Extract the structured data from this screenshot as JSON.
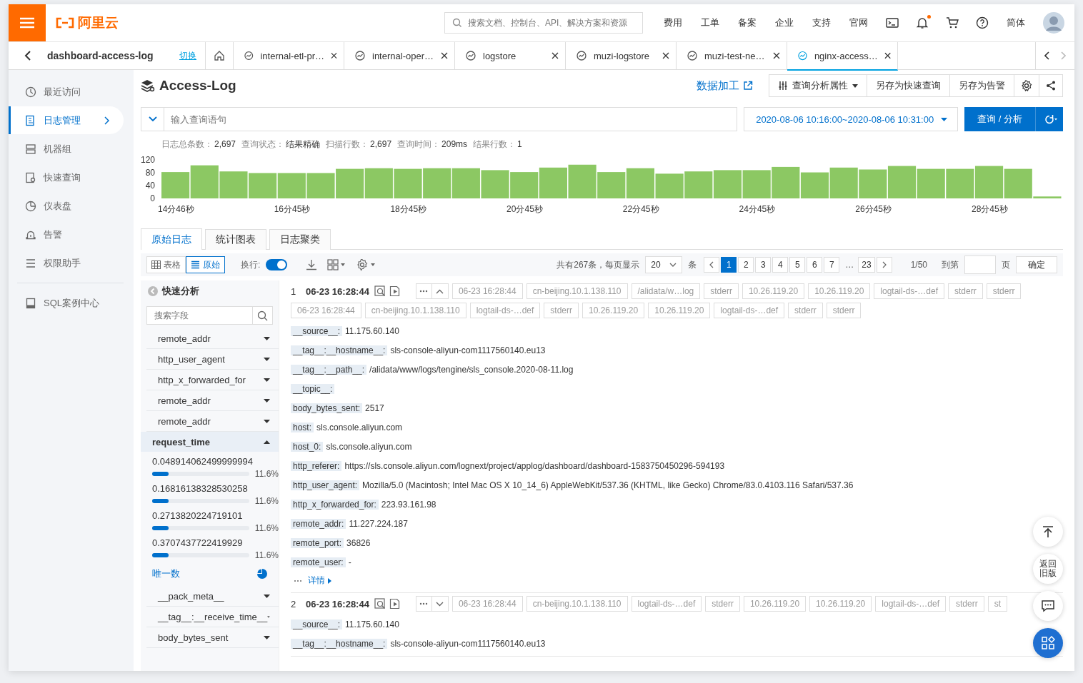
{
  "topbar": {
    "logo": "阿里云",
    "search": {
      "placeholder": "搜索文档、控制台、API、解决方案和资源"
    },
    "links": [
      "费用",
      "工单",
      "备案",
      "企业",
      "支持",
      "官网"
    ],
    "notification_dot": true,
    "language": "简体"
  },
  "tabbar": {
    "project": "dashboard-access-log",
    "switch_link": "切换",
    "tabs": [
      {
        "label": "internal-etl-pr…",
        "selected": false
      },
      {
        "label": "internal-oper…",
        "selected": false
      },
      {
        "label": "logstore",
        "selected": false
      },
      {
        "label": "muzi-logstore",
        "selected": false
      },
      {
        "label": "muzi-test-ne…",
        "selected": false
      },
      {
        "label": "nginx-access…",
        "selected": true
      }
    ]
  },
  "sidebar": {
    "items": [
      {
        "label": "最近访问",
        "selected": false
      },
      {
        "label": "日志管理",
        "selected": true
      },
      {
        "label": "机器组",
        "selected": false
      },
      {
        "label": "快速查询",
        "selected": false
      },
      {
        "label": "仪表盘",
        "selected": false
      },
      {
        "label": "告警",
        "selected": false
      },
      {
        "label": "权限助手",
        "selected": false
      }
    ],
    "footer_items": [
      {
        "label": "SQL案例中心",
        "selected": false
      }
    ]
  },
  "logstore": {
    "title": "Access-Log",
    "data_processing_link": "数据加工",
    "actions": [
      "查询分析属性",
      "另存为快速查询",
      "另存为告警"
    ]
  },
  "query": {
    "placeholder": "输入查询语句",
    "time_range": "2020-08-06 10:16:00~2020-08-06 10:31:00",
    "submit": "查询 / 分析"
  },
  "stats": [
    {
      "label": "日志总条数：",
      "value": "2,697"
    },
    {
      "label": "查询状态：",
      "value": "结果精确"
    },
    {
      "label": "扫描行数：",
      "value": "2,697"
    },
    {
      "label": "查询时间：",
      "value": "209ms"
    },
    {
      "label": "结果行数：",
      "value": "1"
    }
  ],
  "histogram": {
    "chart_data": {
      "type": "bar",
      "values": [
        82,
        103,
        84,
        79,
        79,
        79,
        92,
        94,
        92,
        94,
        94,
        88,
        82,
        96,
        105,
        82,
        94,
        77,
        84,
        88,
        88,
        98,
        81,
        96,
        90,
        101,
        92,
        92,
        101,
        92,
        6
      ],
      "categories": [
        "14分46秒",
        null,
        null,
        null,
        "16分45秒",
        null,
        null,
        null,
        "18分45秒",
        null,
        null,
        null,
        "20分45秒",
        null,
        null,
        null,
        "22分45秒",
        null,
        null,
        null,
        "24分45秒",
        null,
        null,
        null,
        "26分45秒",
        null,
        null,
        null,
        "28分45秒",
        null,
        null
      ],
      "ylim": [
        0,
        120
      ],
      "yticks": [
        0,
        40,
        80,
        120
      ]
    }
  },
  "result_tabs": [
    {
      "label": "原始日志",
      "selected": true
    },
    {
      "label": "统计图表",
      "selected": false
    },
    {
      "label": "日志聚类",
      "selected": false
    }
  ],
  "toolbar": {
    "views": [
      {
        "label": "表格",
        "selected": false
      },
      {
        "label": "原始",
        "selected": true
      }
    ],
    "wrap_label": "换行:",
    "wrap_on": true,
    "pagination": {
      "summary": "共有267条，每页显示",
      "page_size": "20",
      "unit": "条",
      "pages": [
        {
          "label": "1",
          "selected": true
        },
        {
          "label": "2",
          "selected": false
        },
        {
          "label": "3",
          "selected": false
        },
        {
          "label": "4",
          "selected": false
        },
        {
          "label": "5",
          "selected": false
        },
        {
          "label": "6",
          "selected": false
        },
        {
          "label": "7",
          "selected": false
        }
      ],
      "ellipsis": "…",
      "last_page": {
        "label": "23",
        "selected": false
      },
      "position": "1/50",
      "goto_label": "到第",
      "goto_unit": "页",
      "confirm": "确定"
    }
  },
  "quick_analysis": {
    "title": "快速分析",
    "search_placeholder": "搜索字段",
    "fields": [
      {
        "name": "remote_addr",
        "expanded": false
      },
      {
        "name": "http_user_agent",
        "expanded": false
      },
      {
        "name": "http_x_forwarded_for",
        "expanded": false
      },
      {
        "name": "remote_addr",
        "expanded": false
      },
      {
        "name": "remote_addr",
        "expanded": false
      },
      {
        "name": "request_time",
        "expanded": true,
        "distinct_link": "唯一数",
        "values": [
          {
            "value": "0.048914062499999994",
            "level": 0.17,
            "reading": "11.6%"
          },
          {
            "value": "0.16816138328530258",
            "level": 0.17,
            "reading": "11.6%"
          },
          {
            "value": "0.2713820224719101",
            "level": 0.17,
            "reading": "11.6%"
          },
          {
            "value": "0.3707437722419929",
            "level": 0.17,
            "reading": "11.6%"
          }
        ]
      },
      {
        "name": "__pack_meta__",
        "expanded": false
      },
      {
        "name": "__tag__:__receive_time__",
        "expanded": false
      },
      {
        "name": "body_bytes_sent",
        "expanded": false
      }
    ]
  },
  "logs": [
    {
      "index": "1",
      "time": "06-23 16:28:44",
      "expanded": true,
      "tags": [
        "06-23 16:28:44",
        "cn-beijing.10.1.138.110",
        "/alidata/w…log",
        "stderr",
        "10.26.119.20",
        "10.26.119.20",
        "logtail-ds-…def",
        "stderr",
        "stderr",
        "06-23 16:28:44",
        "cn-beijing.10.1.138.110",
        "logtail-ds-…def",
        "stderr",
        "10.26.119.20",
        "10.26.119.20",
        "logtail-ds-…def",
        "stderr",
        "stderr"
      ],
      "fields": [
        {
          "key": "__source__:",
          "value": "11.175.60.140"
        },
        {
          "key": "__tag__:__hostname__:",
          "value": "sls-console-aliyun-com1117560140.eu13"
        },
        {
          "key": "__tag__:__path__:",
          "value": "/alidata/www/logs/tengine/sls_console.2020-08-11.log"
        },
        {
          "key": "__topic__:"
        },
        {
          "key": "body_bytes_sent:",
          "value": "2517"
        },
        {
          "key": "host:",
          "value": "sls.console.aliyun.com"
        },
        {
          "key": "host_0:",
          "value": "sls.console.aliyun.com"
        },
        {
          "key": "http_referer:",
          "value": "https://sls.console.aliyun.com/lognext/project/applog/dashboard/dashboard-1583750450296-594193"
        },
        {
          "key": "http_user_agent:",
          "value": "Mozilla/5.0 (Macintosh; Intel Mac OS X 10_14_6) AppleWebKit/537.36 (KHTML, like Gecko) Chrome/83.0.4103.116 Safari/537.36"
        },
        {
          "key": "http_x_forwarded_for:",
          "value": "223.93.161.98"
        },
        {
          "key": "remote_addr:",
          "value": "11.227.224.187"
        },
        {
          "key": "remote_port:",
          "value": "36826"
        },
        {
          "key": "remote_user:",
          "value": "-"
        }
      ],
      "details_link": "详情"
    },
    {
      "index": "2",
      "time": "06-23 16:28:44",
      "expanded": false,
      "tags": [
        "06-23 16:28:44",
        "cn-beijing.10.1.138.110",
        "logtail-ds-…def",
        "stderr",
        "10.26.119.20",
        "10.26.119.20",
        "logtail-ds-…def",
        "stderr",
        "st"
      ],
      "fields": [
        {
          "key": "__source__:",
          "value": "11.175.60.140"
        },
        {
          "key": "__tag__:__hostname__:",
          "value": "sls-console-aliyun-com1117560140.eu13"
        }
      ]
    }
  ],
  "float_buttons": {
    "old_version": "返回旧版"
  }
}
